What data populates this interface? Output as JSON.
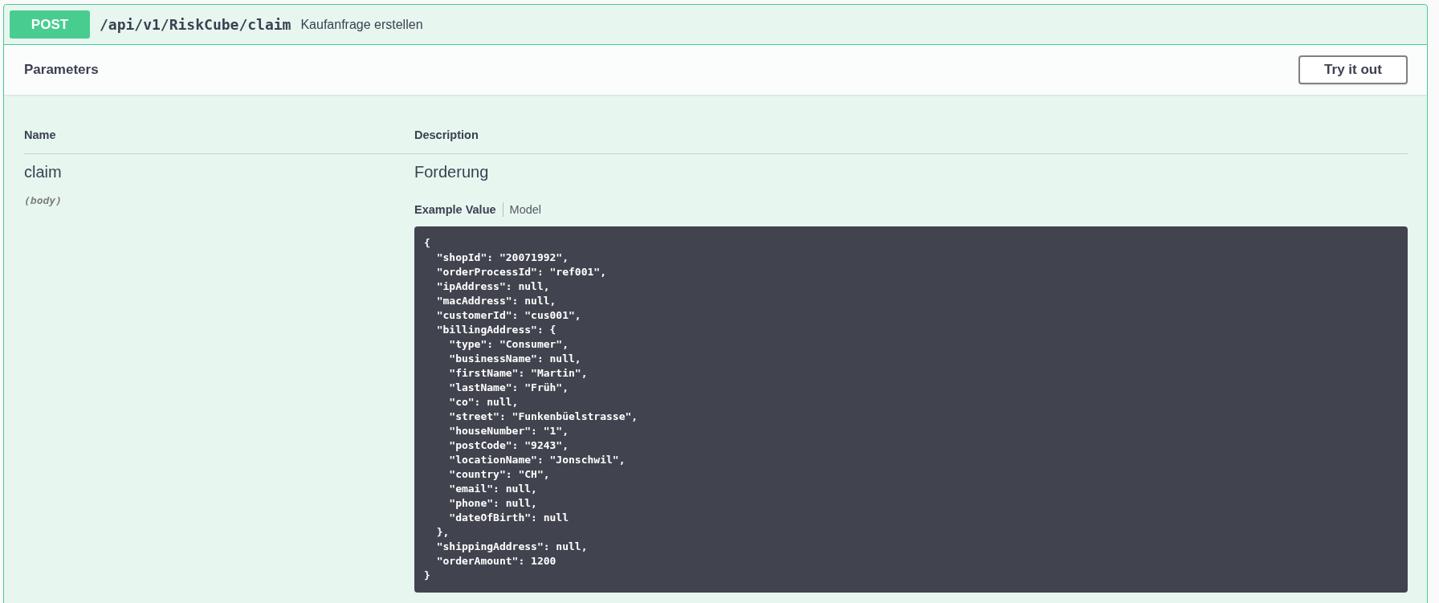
{
  "operation": {
    "method": "POST",
    "path": "/api/v1/RiskCube/claim",
    "summary": "Kaufanfrage erstellen"
  },
  "parameters": {
    "title": "Parameters",
    "try_button": "Try it out",
    "columns": [
      "Name",
      "Description"
    ],
    "rows": [
      {
        "name": "claim",
        "location": "(body)",
        "description": "Forderung",
        "tabs": [
          {
            "label": "Example Value",
            "selected": true
          },
          {
            "label": "Model",
            "selected": false
          }
        ],
        "example_value": [
          "{",
          "  \"shopId\": \"20071992\",",
          "  \"orderProcessId\": \"ref001\",",
          "  \"ipAddress\": null,",
          "  \"macAddress\": null,",
          "  \"customerId\": \"cus001\",",
          "  \"billingAddress\": {",
          "    \"type\": \"Consumer\",",
          "    \"businessName\": null,",
          "    \"firstName\": \"Martin\",",
          "    \"lastName\": \"Früh\",",
          "    \"co\": null,",
          "    \"street\": \"Funkenbüelstrasse\",",
          "    \"houseNumber\": \"1\",",
          "    \"postCode\": \"9243\",",
          "    \"locationName\": \"Jonschwil\",",
          "    \"country\": \"CH\",",
          "    \"email\": null,",
          "    \"phone\": null,",
          "    \"dateOfBirth\": null",
          "  },",
          "  \"shippingAddress\": null,",
          "  \"orderAmount\": 1200",
          "}"
        ]
      }
    ]
  }
}
